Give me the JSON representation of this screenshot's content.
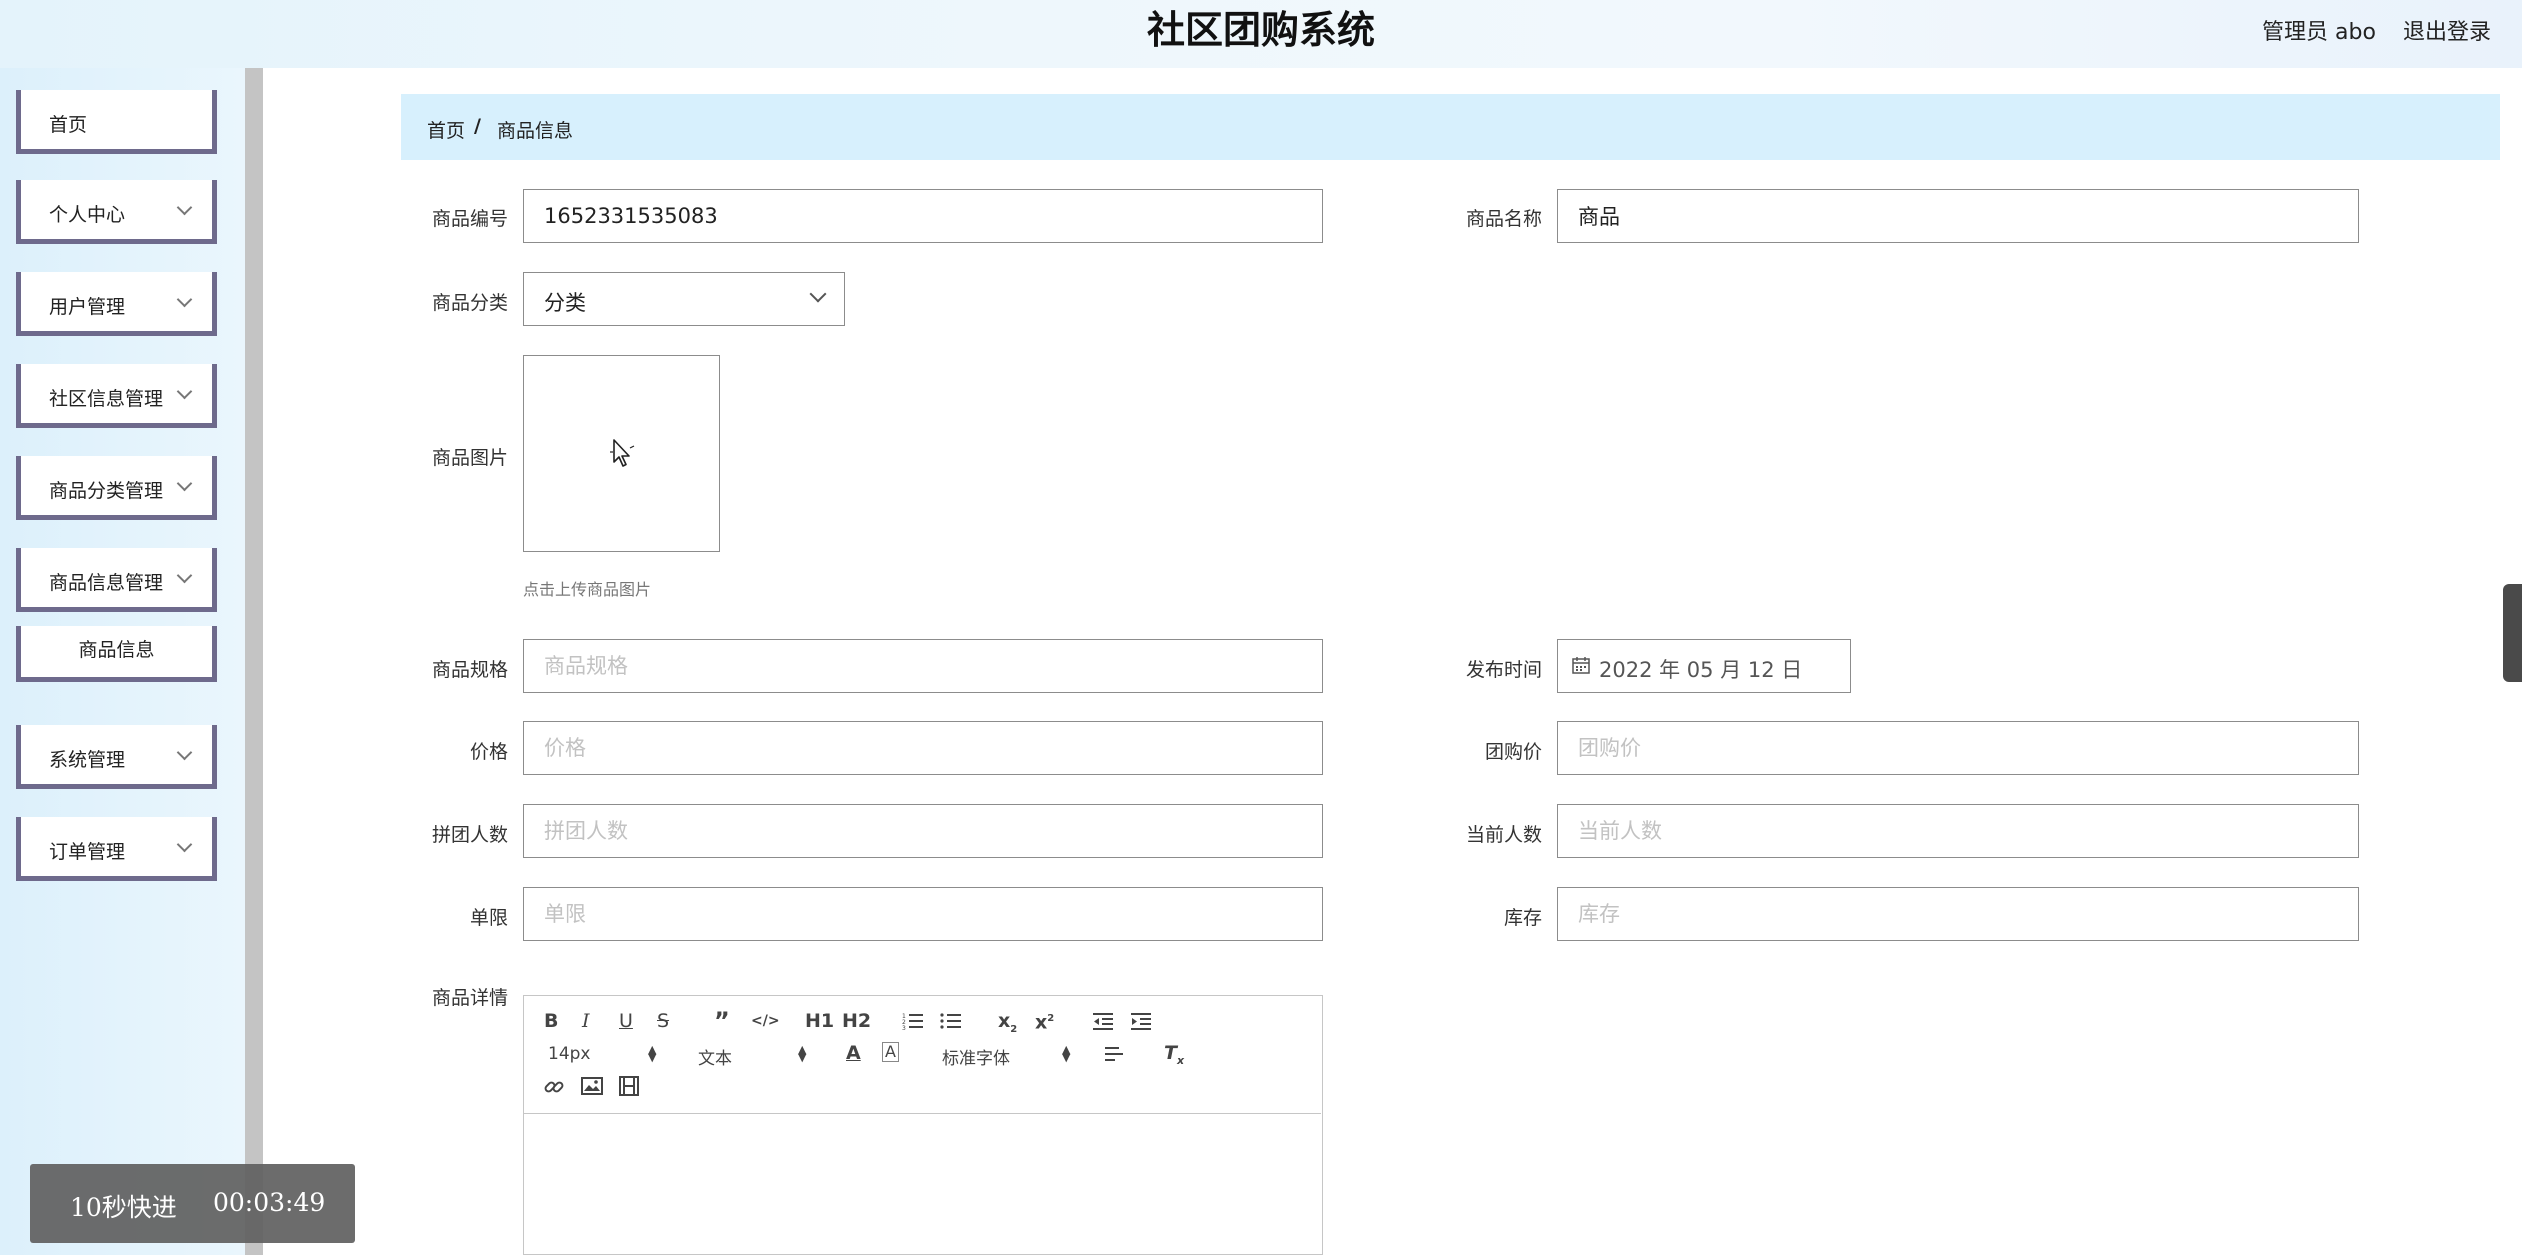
{
  "header": {
    "title": "社区团购系统",
    "user": "管理员 abo",
    "logout": "退出登录"
  },
  "sidebar": {
    "items": [
      {
        "label": "首页"
      },
      {
        "label": "个人中心"
      },
      {
        "label": "用户管理"
      },
      {
        "label": "社区信息管理"
      },
      {
        "label": "商品分类管理"
      },
      {
        "label": "商品信息管理"
      },
      {
        "label": "商品信息"
      },
      {
        "label": "系统管理"
      },
      {
        "label": "订单管理"
      }
    ]
  },
  "breadcrumb": {
    "home": "首页",
    "separator": "/",
    "current": "商品信息"
  },
  "form": {
    "code": {
      "label": "商品编号",
      "value": "1652331535083"
    },
    "name": {
      "label": "商品名称",
      "value": "商品"
    },
    "category": {
      "label": "商品分类",
      "value": "分类"
    },
    "image": {
      "label": "商品图片",
      "hint": "点击上传商品图片"
    },
    "spec": {
      "label": "商品规格",
      "placeholder": "商品规格"
    },
    "publish_time": {
      "label": "发布时间",
      "value": "2022 年 05 月 12 日"
    },
    "price": {
      "label": "价格",
      "placeholder": "价格"
    },
    "group_price": {
      "label": "团购价",
      "placeholder": "团购价"
    },
    "group_size": {
      "label": "拼团人数",
      "placeholder": "拼团人数"
    },
    "current_count": {
      "label": "当前人数",
      "placeholder": "当前人数"
    },
    "limit": {
      "label": "单限",
      "placeholder": "单限"
    },
    "stock": {
      "label": "库存",
      "placeholder": "库存"
    },
    "detail": {
      "label": "商品详情"
    }
  },
  "editor": {
    "h1": "H1",
    "h2": "H2",
    "font_size": "14px",
    "block_type": "文本",
    "font_family": "标准字体"
  },
  "playback": {
    "skip": "10秒快进",
    "time": "00:03:49"
  }
}
